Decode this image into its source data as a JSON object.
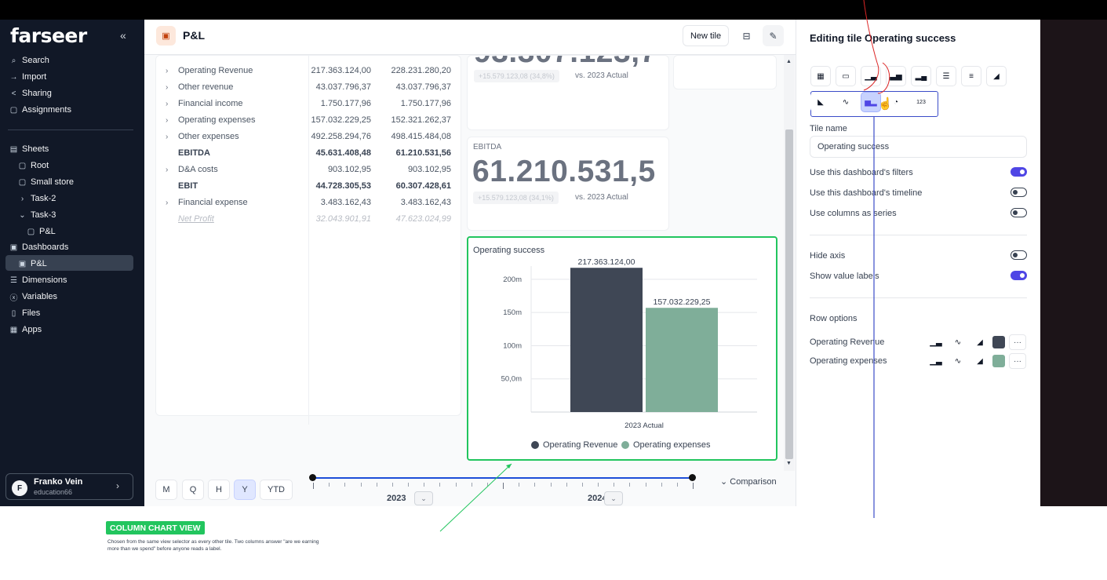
{
  "sidebar": {
    "logo": "farseer",
    "nav": [
      {
        "label": "Search",
        "icon": "search-icon"
      },
      {
        "label": "Import",
        "icon": "import-icon"
      },
      {
        "label": "Sharing",
        "icon": "share-icon"
      },
      {
        "label": "Assignments",
        "icon": "assignment-icon"
      }
    ],
    "tree": [
      {
        "label": "Sheets",
        "icon": "sheets-icon"
      },
      {
        "label": "Root",
        "icon": "sheet-icon"
      },
      {
        "label": "Small store",
        "icon": "sheet-icon"
      },
      {
        "label": "Task-2",
        "icon": "chevron-right-icon"
      },
      {
        "label": "Task-3",
        "icon": "chevron-down-icon"
      },
      {
        "label": "P&L",
        "icon": "sheet-icon"
      },
      {
        "label": "Dashboards",
        "icon": "dashboard-icon"
      },
      {
        "label": "P&L",
        "icon": "dashboard-icon"
      },
      {
        "label": "Dimensions",
        "icon": "dimensions-icon"
      },
      {
        "label": "Variables",
        "icon": "variables-icon"
      },
      {
        "label": "Files",
        "icon": "files-icon"
      },
      {
        "label": "Apps",
        "icon": "apps-icon"
      }
    ],
    "user": {
      "initial": "F",
      "name": "Franko Vein",
      "sub": "education66"
    }
  },
  "header": {
    "title": "P&L",
    "new_tile": "New tile"
  },
  "table": {
    "rows": [
      {
        "label": "Operating Revenue",
        "v1": "217.363.124,00",
        "v2": "228.231.280,20",
        "expandable": true,
        "style": ""
      },
      {
        "label": "Other revenue",
        "v1": "43.037.796,37",
        "v2": "43.037.796,37",
        "expandable": true,
        "style": ""
      },
      {
        "label": "Financial income",
        "v1": "1.750.177,96",
        "v2": "1.750.177,96",
        "expandable": true,
        "style": ""
      },
      {
        "label": "Operating expenses",
        "v1": "157.032.229,25",
        "v2": "152.321.262,37",
        "expandable": true,
        "style": ""
      },
      {
        "label": "Other expenses",
        "v1": "492.258.294,76",
        "v2": "498.415.484,08",
        "expandable": true,
        "style": ""
      },
      {
        "label": "EBITDA",
        "v1": "45.631.408,48",
        "v2": "61.210.531,56",
        "expandable": false,
        "style": "bold"
      },
      {
        "label": "D&A costs",
        "v1": "903.102,95",
        "v2": "903.102,95",
        "expandable": true,
        "style": ""
      },
      {
        "label": "EBIT",
        "v1": "44.728.305,53",
        "v2": "60.307.428,61",
        "expandable": false,
        "style": "bold"
      },
      {
        "label": "Financial expense",
        "v1": "3.483.162,43",
        "v2": "3.483.162,43",
        "expandable": true,
        "style": ""
      },
      {
        "label": "Net Profit",
        "v1": "32.043.901,91",
        "v2": "47.623.024,99",
        "expandable": false,
        "style": "dim"
      }
    ]
  },
  "kpi_top": {
    "delta": "+15.579.123,08 (34,8%)",
    "vs": "vs. 2023 Actual"
  },
  "kpi_ebitda": {
    "label": "EBITDA",
    "value": "61.210.531,5",
    "delta": "+15.579.123,08 (34,1%)",
    "vs": "vs. 2023 Actual"
  },
  "chart_tile": {
    "title": "Operating success"
  },
  "chart_data": {
    "type": "bar",
    "title": "Operating success",
    "categories": [
      "2023 Actual"
    ],
    "series": [
      {
        "name": "Operating Revenue",
        "values": [
          217363124.0
        ],
        "label": "217.363.124,00",
        "color": "#3f4755"
      },
      {
        "name": "Operating expenses",
        "values": [
          157032229.25
        ],
        "label": "157.032.229,25",
        "color": "#7fae99"
      }
    ],
    "yticks": [
      {
        "value": 50000000,
        "label": "50,0m"
      },
      {
        "value": 100000000,
        "label": "100m"
      },
      {
        "value": 150000000,
        "label": "150m"
      },
      {
        "value": 200000000,
        "label": "200m"
      }
    ],
    "ylim": [
      0,
      220000000
    ],
    "legend": "bottom",
    "grid": true
  },
  "timeline": {
    "periods": [
      "M",
      "Q",
      "H",
      "Y",
      "YTD"
    ],
    "selected": "Y",
    "years": [
      "2023",
      "2024"
    ],
    "comparison": "Comparison"
  },
  "panel": {
    "title": "Editing tile Operating success",
    "view_icons_row1": [
      "table-icon",
      "card-icon",
      "column-icon",
      "stacked-column-icon",
      "waterfall-icon",
      "bar-icon",
      "stacked-bar-icon",
      "area-icon"
    ],
    "view_icons_row2": [
      "stacked-area-icon",
      "line-icon",
      "clustered-column-icon",
      "pie-icon",
      "number-icon"
    ],
    "number_icon_text": "123",
    "tile_name_label": "Tile name",
    "tile_name_value": "Operating success",
    "toggles": [
      {
        "label": "Use this dashboard's filters",
        "on": true
      },
      {
        "label": "Use this dashboard's timeline",
        "on": false
      },
      {
        "label": "Use columns as series",
        "on": false
      },
      {
        "label": "Hide axis",
        "on": false
      },
      {
        "label": "Show value labels",
        "on": true
      }
    ],
    "row_options_title": "Row options",
    "row_options": [
      {
        "label": "Operating Revenue",
        "color": "#3f4755"
      },
      {
        "label": "Operating expenses",
        "color": "#7fae99"
      }
    ],
    "more": "···"
  },
  "annotation": {
    "badge": "COLUMN CHART VIEW",
    "text": "Chosen from the same view selector as every other tile. Two columns answer \"are we earning more than we spend\" before anyone reads a label."
  },
  "colors": {
    "sidebar": "#111827",
    "accent": "#4f46e5",
    "highlight": "#22c55e"
  }
}
